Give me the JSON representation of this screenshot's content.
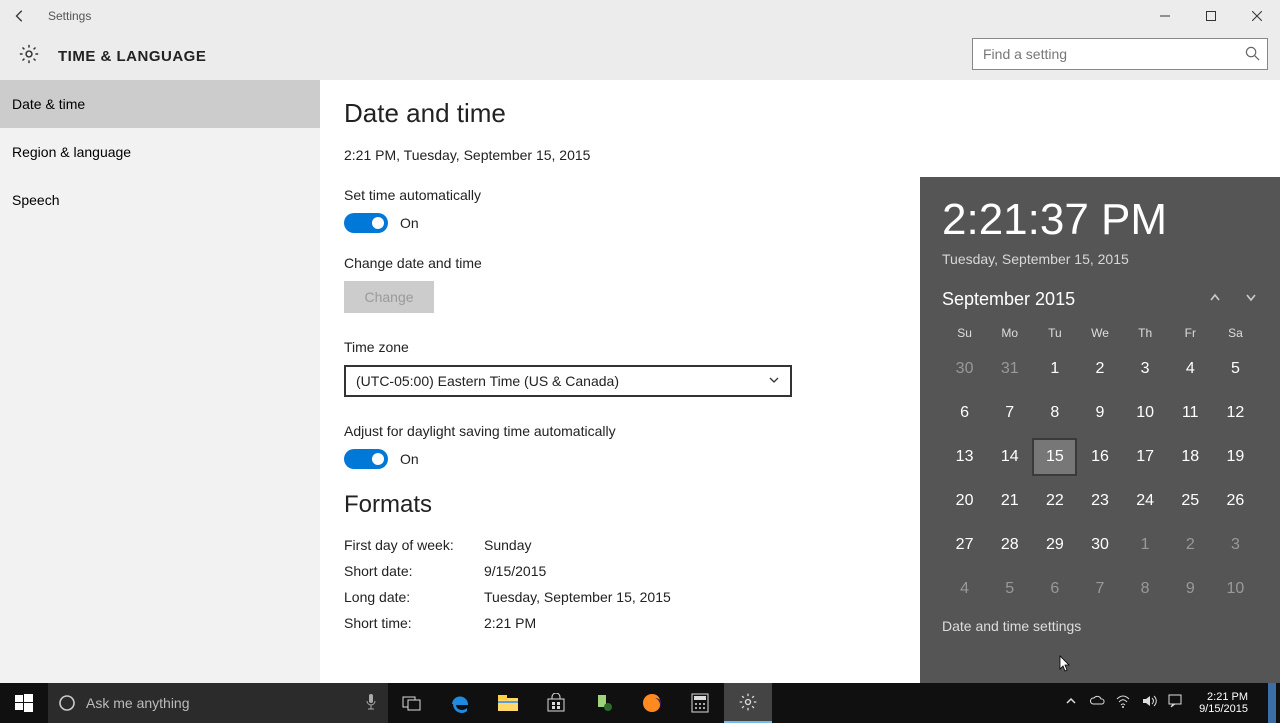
{
  "titlebar": {
    "title": "Settings"
  },
  "header": {
    "title": "TIME & LANGUAGE",
    "search_placeholder": "Find a setting"
  },
  "sidebar": {
    "items": [
      {
        "label": "Date & time",
        "selected": true
      },
      {
        "label": "Region & language",
        "selected": false
      },
      {
        "label": "Speech",
        "selected": false
      }
    ]
  },
  "main": {
    "heading": "Date and time",
    "current": "2:21 PM, Tuesday, September 15, 2015",
    "auto_time_label": "Set time automatically",
    "auto_time_state": "On",
    "change_label": "Change date and time",
    "change_button": "Change",
    "timezone_label": "Time zone",
    "timezone_value": "(UTC-05:00) Eastern Time (US & Canada)",
    "dst_label": "Adjust for daylight saving time automatically",
    "dst_state": "On",
    "formats_heading": "Formats",
    "formats": [
      {
        "k": "First day of week:",
        "v": "Sunday"
      },
      {
        "k": "Short date:",
        "v": "9/15/2015"
      },
      {
        "k": "Long date:",
        "v": "Tuesday, September 15, 2015"
      },
      {
        "k": "Short time:",
        "v": "2:21 PM"
      }
    ]
  },
  "flyout": {
    "time": "2:21:37 PM",
    "date": "Tuesday, September 15, 2015",
    "month": "September 2015",
    "weekdays": [
      "Su",
      "Mo",
      "Tu",
      "We",
      "Th",
      "Fr",
      "Sa"
    ],
    "days": [
      {
        "n": "30",
        "dim": true
      },
      {
        "n": "31",
        "dim": true
      },
      {
        "n": "1"
      },
      {
        "n": "2"
      },
      {
        "n": "3"
      },
      {
        "n": "4"
      },
      {
        "n": "5"
      },
      {
        "n": "6"
      },
      {
        "n": "7"
      },
      {
        "n": "8"
      },
      {
        "n": "9"
      },
      {
        "n": "10"
      },
      {
        "n": "11"
      },
      {
        "n": "12"
      },
      {
        "n": "13"
      },
      {
        "n": "14"
      },
      {
        "n": "15",
        "today": true
      },
      {
        "n": "16"
      },
      {
        "n": "17"
      },
      {
        "n": "18"
      },
      {
        "n": "19"
      },
      {
        "n": "20"
      },
      {
        "n": "21"
      },
      {
        "n": "22"
      },
      {
        "n": "23"
      },
      {
        "n": "24"
      },
      {
        "n": "25"
      },
      {
        "n": "26"
      },
      {
        "n": "27"
      },
      {
        "n": "28"
      },
      {
        "n": "29"
      },
      {
        "n": "30"
      },
      {
        "n": "1",
        "dim": true
      },
      {
        "n": "2",
        "dim": true
      },
      {
        "n": "3",
        "dim": true
      },
      {
        "n": "4",
        "dim": true
      },
      {
        "n": "5",
        "dim": true
      },
      {
        "n": "6",
        "dim": true
      },
      {
        "n": "7",
        "dim": true
      },
      {
        "n": "8",
        "dim": true
      },
      {
        "n": "9",
        "dim": true
      },
      {
        "n": "10",
        "dim": true
      }
    ],
    "settings_link": "Date and time settings"
  },
  "taskbar": {
    "cortana_placeholder": "Ask me anything",
    "clock_time": "2:21 PM",
    "clock_date": "9/15/2015"
  }
}
